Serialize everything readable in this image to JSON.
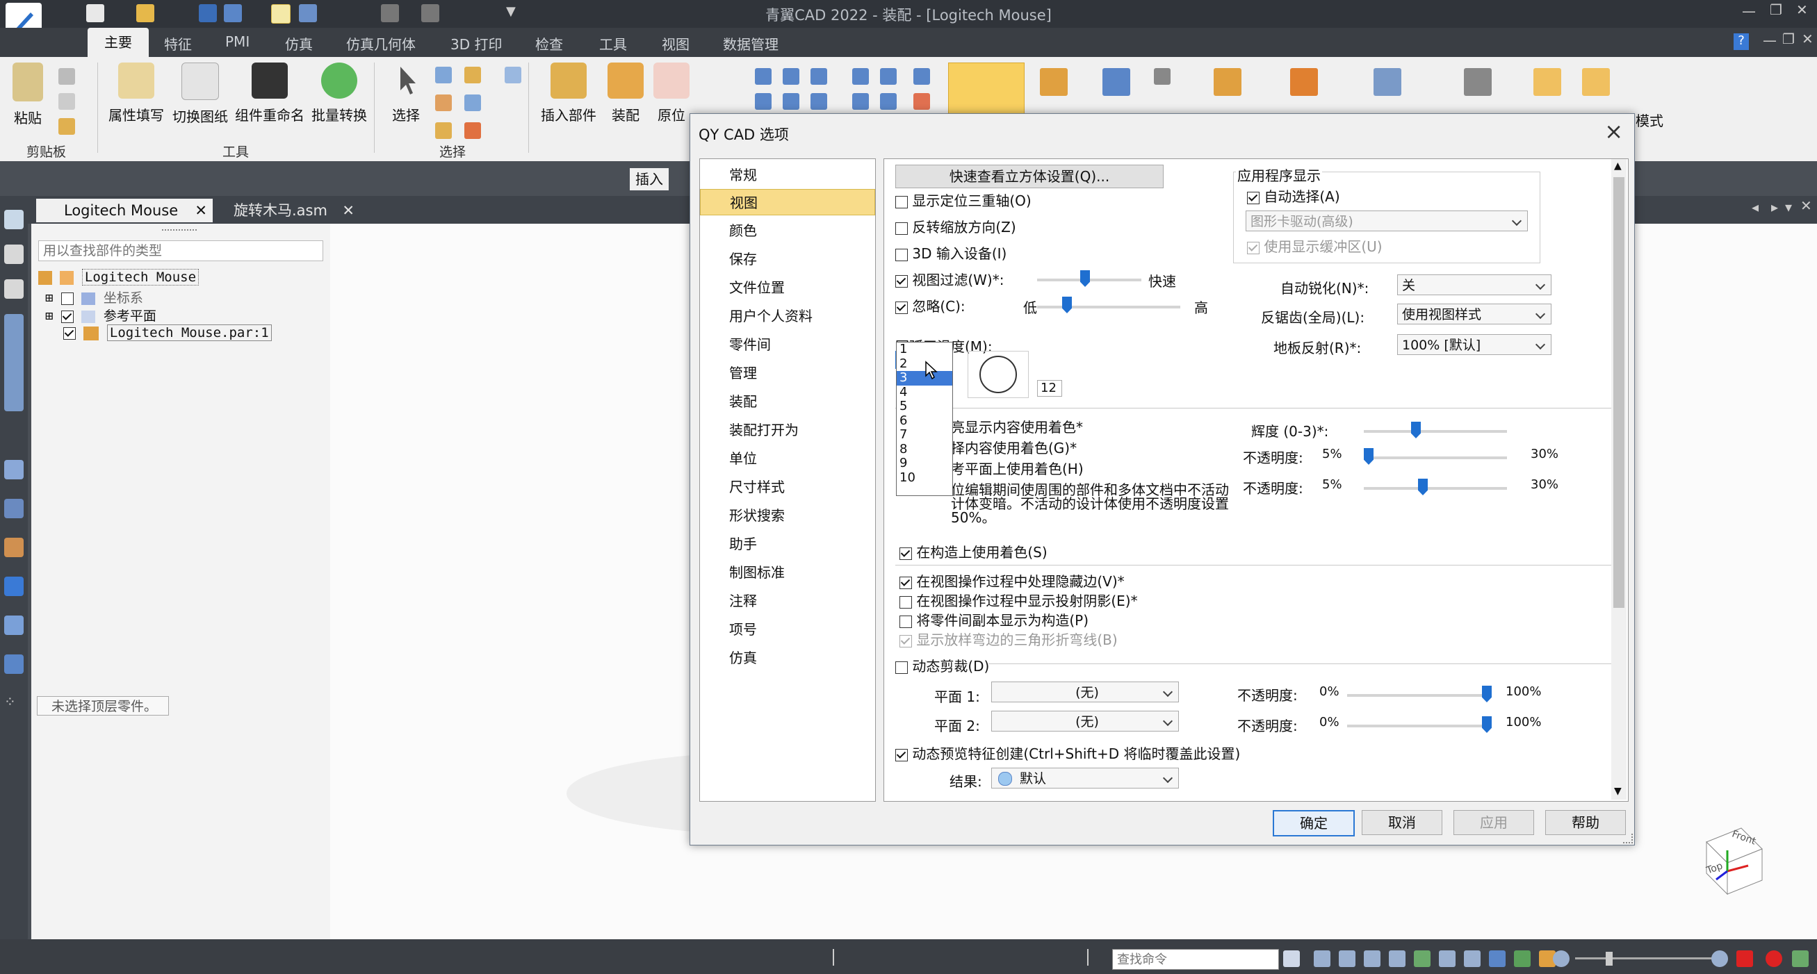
{
  "app": {
    "title": "青翼CAD 2022 - 装配 - [Logitech Mouse]"
  },
  "menu": {
    "tabs": [
      "主要",
      "特征",
      "PMI",
      "仿真",
      "仿真几何体",
      "3D 打印",
      "检查",
      "工具",
      "视图",
      "数据管理"
    ],
    "active": "主要"
  },
  "ribbon": {
    "clipboard": {
      "paste": "粘贴",
      "group": "剪贴板"
    },
    "tools": {
      "b1": "属性填写",
      "b2": "切换图纸",
      "b3": "组件重命名",
      "b4": "批量转换",
      "group": "工具"
    },
    "select": {
      "b1": "选择",
      "group": "选择"
    },
    "assembly": {
      "insert": "插入部件",
      "assemble": "装配",
      "origin": "原位",
      "mode": "模式"
    }
  },
  "doc_tabs": [
    "Logitech Mouse",
    "旋转木马.asm"
  ],
  "insert_tab": "插入",
  "pathfinder": {
    "search_placeholder": "用以查找部件的类型",
    "tree": [
      "Logitech Mouse",
      "坐标系",
      "参考平面",
      "Logitech Mouse.par:1"
    ],
    "status": "未选择顶层零件。"
  },
  "statusbar": {
    "command_placeholder": "查找命令"
  },
  "viewcube": {
    "face1": "Top",
    "face2": "Front"
  },
  "dialog": {
    "title": "QY CAD 选项",
    "categories": [
      "常规",
      "视图",
      "颜色",
      "保存",
      "文件位置",
      "用户个人资料",
      "零件间",
      "管理",
      "装配",
      "装配打开为",
      "单位",
      "尺寸样式",
      "形状搜索",
      "助手",
      "制图标准",
      "注释",
      "项号",
      "仿真"
    ],
    "selected_category": "视图",
    "quick_cube_button": "快速查看立方体设置(Q)...",
    "app_display_group": "应用程序显示",
    "auto_select": "自动选择(A)",
    "graphics_driver": "图形卡驱动(高级)",
    "use_display_buffer": "使用显示缓冲区(U)",
    "show_triad": "显示定位三重轴(O)",
    "reverse_zoom": "反转缩放方向(Z)",
    "input_3d": "3D 输入设备(I)",
    "view_filter": "视图过滤(W)*:",
    "view_filter_right": "快速",
    "ignore": "忽略(C):",
    "ignore_low": "低",
    "ignore_high": "高",
    "auto_sharpen_label": "自动锐化(N)*:",
    "auto_sharpen_value": "关",
    "antialias_label": "反锯齿(全局)(L):",
    "antialias_value": "使用视图样式",
    "floor_reflect_label": "地板反射(R)*:",
    "floor_reflect_value": "100% [默认]",
    "arc_smooth_label": "圆弧平滑度(M):",
    "arc_smooth_value": "3",
    "arc_smooth_options": [
      "1",
      "2",
      "3",
      "4",
      "5",
      "6",
      "7",
      "8",
      "9",
      "10"
    ],
    "arc_preview_count": "12",
    "highlight_line": "亮显示内容使用着色*",
    "select_line": "择内容使用着色(G)*",
    "ref_plane_line": "考平面上使用着色(H)",
    "inplace_line1": "位编辑期间使周围的部件和多体文档中不活动",
    "inplace_line2": "计体变暗。不活动的设计体使用不透明度设置",
    "inplace_line3": "50%。",
    "brightness_label": "辉度 (0-3)*:",
    "opacity_label": "不透明度:",
    "opacity_min": "5%",
    "opacity_max": "30%",
    "use_shading_construct": "在构造上使用着色(S)",
    "hidden_edges": "在视图操作过程中处理隐藏边(V)*",
    "cast_shadows": "在视图操作过程中显示投射阴影(E)*",
    "interpart_construct": "将零件间副本显示为构造(P)",
    "lofted_triangles": "显示放样弯边的三角形折弯线(B)",
    "dynamic_clip": "动态剪裁(D)",
    "plane1_label": "平面 1:",
    "plane2_label": "平面 2:",
    "plane_value": "(无)",
    "clip_opacity_label": "不透明度:",
    "clip_opacity_min": "0%",
    "clip_opacity_max": "100%",
    "dynamic_preview": "动态预览特征创建(Ctrl+Shift+D 将临时覆盖此设置)",
    "result_label": "结果:",
    "result_value": "默认",
    "buttons": {
      "ok": "确定",
      "cancel": "取消",
      "apply": "应用",
      "help": "帮助"
    }
  }
}
